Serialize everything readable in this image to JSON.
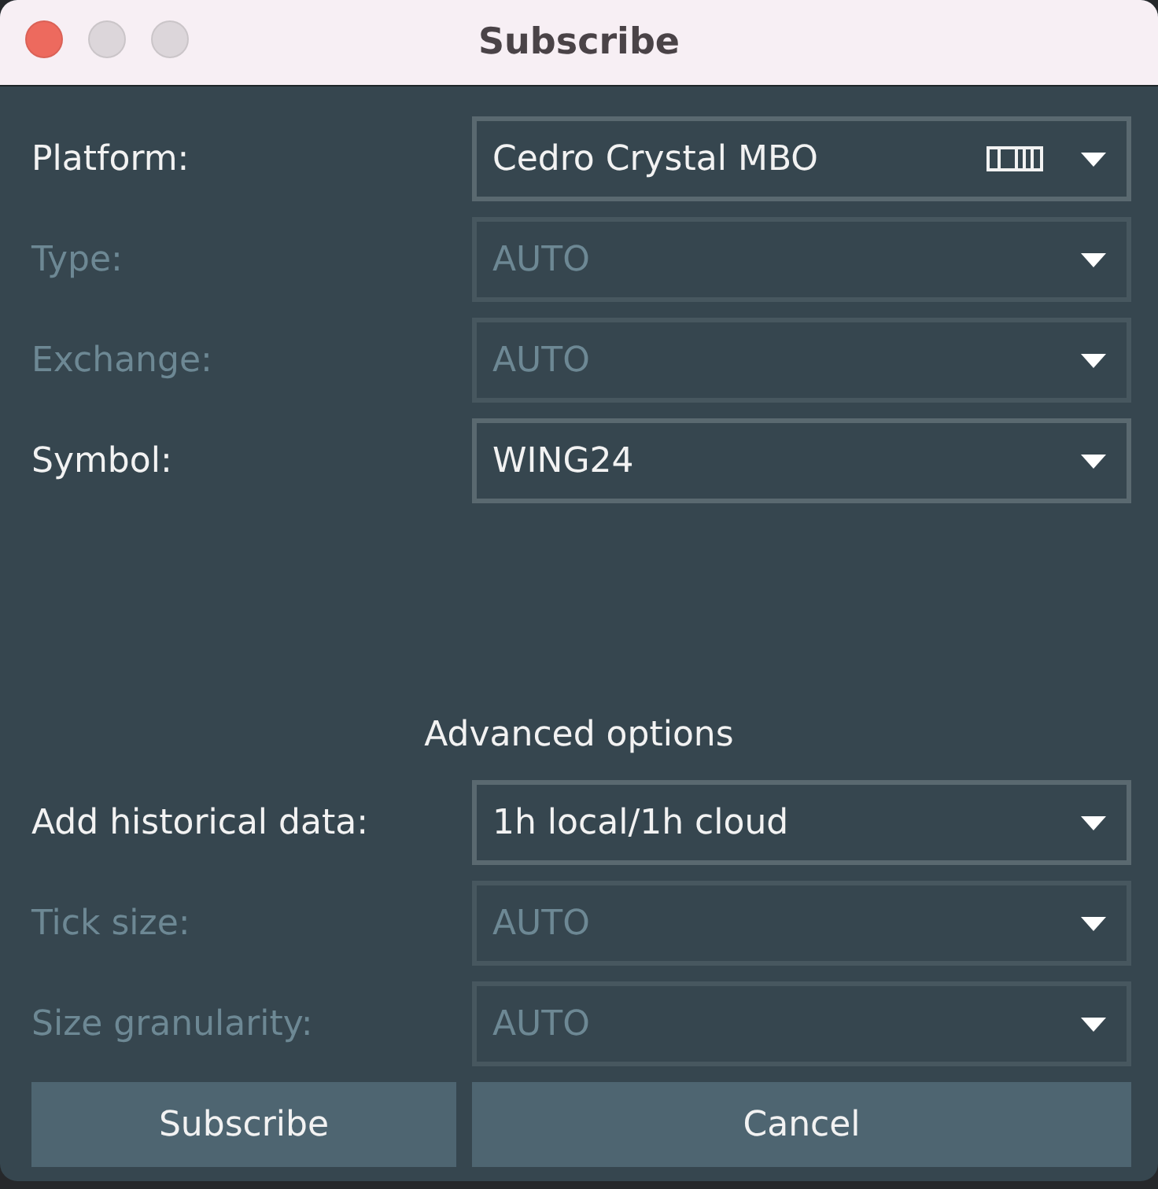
{
  "window": {
    "title": "Subscribe",
    "controls": [
      {
        "kind": "close",
        "disabled": false
      },
      {
        "kind": "minimize",
        "disabled": true
      },
      {
        "kind": "zoom",
        "disabled": true
      }
    ]
  },
  "fields": [
    {
      "label": "Platform:",
      "value": "Cedro Crystal MBO",
      "disabled": false,
      "has_icon": true
    },
    {
      "label": "Type:",
      "value": "AUTO",
      "disabled": true
    },
    {
      "label": "Exchange:",
      "value": "AUTO",
      "disabled": true
    },
    {
      "label": "Symbol:",
      "value": "WING24",
      "disabled": false
    }
  ],
  "advanced": {
    "title": "Advanced options",
    "fields": [
      {
        "label": "Add historical data:",
        "value": "1h local/1h cloud",
        "disabled": false
      },
      {
        "label": "Tick size:",
        "value": "AUTO",
        "disabled": true
      },
      {
        "label": "Size granularity:",
        "value": "AUTO",
        "disabled": true
      }
    ]
  },
  "buttons": [
    {
      "label": "Subscribe"
    },
    {
      "label": "Cancel"
    }
  ]
}
